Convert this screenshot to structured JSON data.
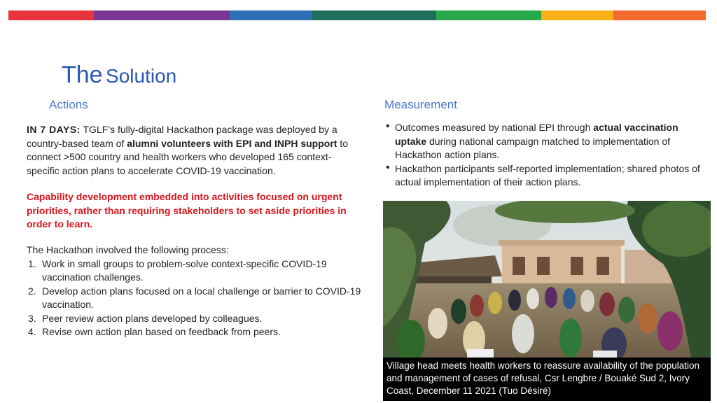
{
  "stripe_colors": [
    "#e8353d",
    "#7b3594",
    "#2f6fb5",
    "#1f6f5c",
    "#27a84a",
    "#f7b017",
    "#f26a2d"
  ],
  "title": {
    "word1": "The",
    "word2": "Solution"
  },
  "actions": {
    "heading": "Actions",
    "intro": {
      "lead": "IN 7 DAYS:",
      "t1": " TGLF’s fully-digital Hackathon package was deployed by a country-based team of ",
      "bold1": "alumni volunteers with EPI and INPH support",
      "t2": " to connect >500 country and health workers who developed 165 context-specific action plans to accelerate COVID-19 vaccination."
    },
    "capability": "Capability development embedded into activities focused on urgent priorities, rather than requiring stakeholders to set aside priorities in order to learn.",
    "process_intro": "The Hackathon involved the following process:",
    "steps": [
      {
        "num": "1.",
        "text": "Work in small groups to problem-solve context-specific COVID-19 vaccination challenges."
      },
      {
        "num": "2.",
        "text": "Develop action plans focused on a local challenge or barrier to COVID-19 vaccination."
      },
      {
        "num": "3.",
        "text": "Peer review action plans developed by colleagues."
      },
      {
        "num": "4.",
        "text": "Revise own action plan based on feedback from peers."
      }
    ]
  },
  "measurement": {
    "heading": "Measurement",
    "b1": {
      "t1": "Outcomes measured by national EPI through ",
      "bold": "actual vaccination uptake",
      "t2": " during national campaign matched to implementation of Hackathon action plans."
    },
    "b2": "Hackathon participants self-reported implementation; shared photos of actual implementation of their action plans."
  },
  "photo": {
    "caption": "Village head meets health workers to reassure availability of the population and management of cases of refusal, Csr Lengbre / Bouaké Sud 2, Ivory Coast, December 11 2021 (Tuo Désiré)"
  }
}
